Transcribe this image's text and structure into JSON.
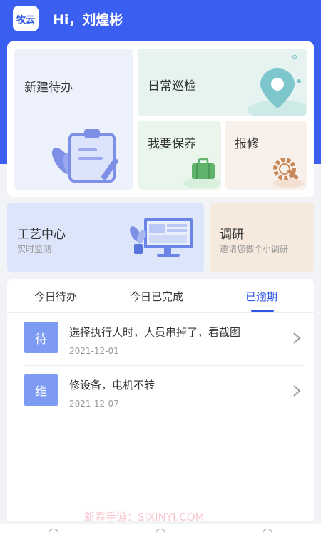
{
  "app": {
    "logo_text": "牧云",
    "greeting": "Hi，刘煌彬"
  },
  "tiles": {
    "new_todo": "新建待办",
    "daily_patrol": "日常巡检",
    "maintenance": "我要保养",
    "repair": "报修"
  },
  "banners": {
    "craft_title": "工艺中心",
    "craft_sub": "实时监测",
    "survey_title": "调研",
    "survey_sub": "邀请您做个小调研"
  },
  "tabs": [
    {
      "label": "今日待办",
      "active": false
    },
    {
      "label": "今日已完成",
      "active": false
    },
    {
      "label": "已逾期",
      "active": true
    }
  ],
  "tasks": [
    {
      "badge": "待",
      "title": "选择执行人时，人员串掉了，看截图",
      "date": "2021-12-01"
    },
    {
      "badge": "维",
      "title": "修设备，电机不转",
      "date": "2021-12-07"
    }
  ],
  "watermark": "新春手游：SIXINYI.COM",
  "colors": {
    "primary": "#2f56e6",
    "header": "#3a5ef0",
    "badge": "#7d9bf2"
  }
}
